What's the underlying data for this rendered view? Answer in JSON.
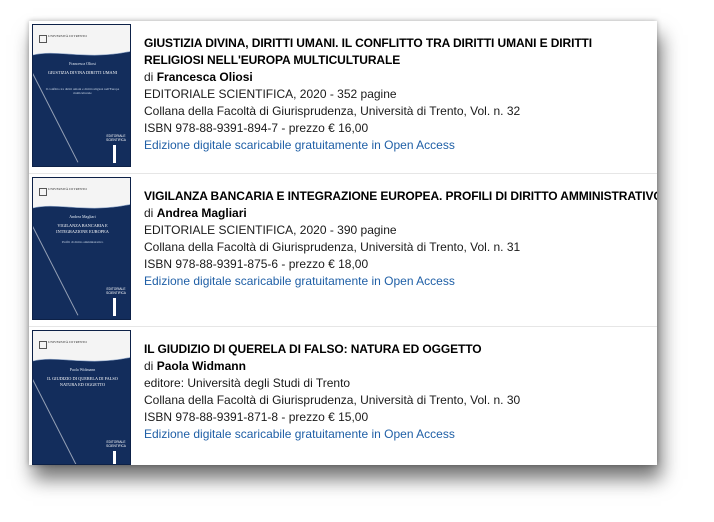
{
  "colors": {
    "cover_blue": "#132d5c",
    "link_blue": "#1f5fa6"
  },
  "books": [
    {
      "title": "GIUSTIZIA DIVINA, DIRITTI UMANI. IL CONFLITTO TRA DIRITTI UMANI E DIRITTI RELIGIOSI NELL'EUROPA MULTICULTURALE",
      "author_prefix": "di",
      "author": "Francesca Oliosi",
      "publisher": "EDITORIALE SCIENTIFICA, 2020 - 352 pagine",
      "series": "Collana della Facoltà di Giurisprudenza, Università di Trento, Vol. n. 32",
      "isbn_price": "ISBN 978-88-9391-894-7 - prezzo  € 16,00",
      "link": "Edizione digitale scaricabile gratuitamente in Open Access",
      "cover": {
        "logo": "UNIVERSITÀ DI TRENTO",
        "author": "Francesca Oliosi",
        "title": "GIUSTIZIA DIVINA DIRITTI UMANI",
        "subtitle": "Il conflitto tra diritti umani e diritti religiosi nell'Europa multiculturale",
        "publisher": "EDITORIALE SCIENTIFICA"
      }
    },
    {
      "title": "VIGILANZA BANCARIA E INTEGRAZIONE EUROPEA. PROFILI DI DIRITTO AMMINISTRATIVO",
      "author_prefix": "di",
      "author": "Andrea Magliari",
      "publisher": "EDITORIALE SCIENTIFICA, 2020 - 390 pagine",
      "series": "Collana della Facoltà di Giurisprudenza, Università di Trento, Vol. n. 31",
      "isbn_price": "ISBN 978-88-9391-875-6 - prezzo  € 18,00",
      "link": "Edizione digitale scaricabile gratuitamente in Open Access",
      "cover": {
        "logo": "UNIVERSITÀ DI TRENTO",
        "author": "Andrea Magliari",
        "title": "VIGILANZA BANCARIA E INTEGRAZIONE EUROPEA",
        "subtitle": "Profili di diritto amministrativo",
        "publisher": "EDITORIALE SCIENTIFICA"
      }
    },
    {
      "title": "IL GIUDIZIO DI QUERELA DI FALSO: NATURA ED OGGETTO",
      "author_prefix": "di",
      "author": "Paola Widmann",
      "publisher": "editore: Università degli Studi di Trento",
      "series": "Collana della Facoltà di Giurisprudenza, Università di Trento, Vol. n. 30",
      "isbn_price": "ISBN 978-88-9391-871-8 - prezzo  € 15,00",
      "link": "Edizione digitale scaricabile gratuitamente in Open Access",
      "cover": {
        "logo": "UNIVERSITÀ DI TRENTO",
        "author": "Paola Widmann",
        "title": "IL GIUDIZIO DI QUERELA DI FALSO NATURA ED OGGETTO",
        "subtitle": "",
        "publisher": "EDITORIALE SCIENTIFICA"
      }
    }
  ]
}
